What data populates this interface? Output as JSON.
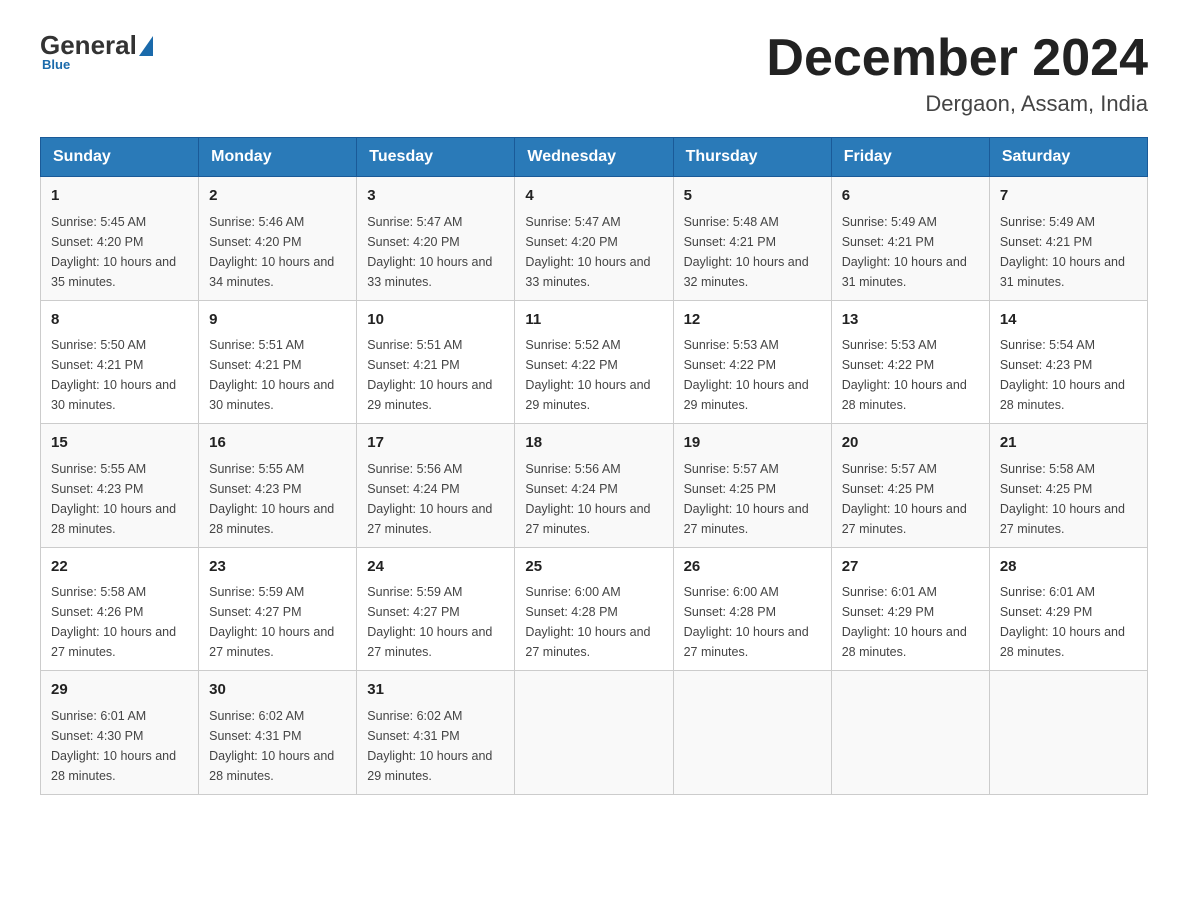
{
  "logo": {
    "general": "General",
    "blue": "Blue",
    "tagline": "Blue"
  },
  "title": {
    "month_year": "December 2024",
    "location": "Dergaon, Assam, India"
  },
  "headers": [
    "Sunday",
    "Monday",
    "Tuesday",
    "Wednesday",
    "Thursday",
    "Friday",
    "Saturday"
  ],
  "weeks": [
    [
      {
        "day": "1",
        "sunrise": "Sunrise: 5:45 AM",
        "sunset": "Sunset: 4:20 PM",
        "daylight": "Daylight: 10 hours and 35 minutes."
      },
      {
        "day": "2",
        "sunrise": "Sunrise: 5:46 AM",
        "sunset": "Sunset: 4:20 PM",
        "daylight": "Daylight: 10 hours and 34 minutes."
      },
      {
        "day": "3",
        "sunrise": "Sunrise: 5:47 AM",
        "sunset": "Sunset: 4:20 PM",
        "daylight": "Daylight: 10 hours and 33 minutes."
      },
      {
        "day": "4",
        "sunrise": "Sunrise: 5:47 AM",
        "sunset": "Sunset: 4:20 PM",
        "daylight": "Daylight: 10 hours and 33 minutes."
      },
      {
        "day": "5",
        "sunrise": "Sunrise: 5:48 AM",
        "sunset": "Sunset: 4:21 PM",
        "daylight": "Daylight: 10 hours and 32 minutes."
      },
      {
        "day": "6",
        "sunrise": "Sunrise: 5:49 AM",
        "sunset": "Sunset: 4:21 PM",
        "daylight": "Daylight: 10 hours and 31 minutes."
      },
      {
        "day": "7",
        "sunrise": "Sunrise: 5:49 AM",
        "sunset": "Sunset: 4:21 PM",
        "daylight": "Daylight: 10 hours and 31 minutes."
      }
    ],
    [
      {
        "day": "8",
        "sunrise": "Sunrise: 5:50 AM",
        "sunset": "Sunset: 4:21 PM",
        "daylight": "Daylight: 10 hours and 30 minutes."
      },
      {
        "day": "9",
        "sunrise": "Sunrise: 5:51 AM",
        "sunset": "Sunset: 4:21 PM",
        "daylight": "Daylight: 10 hours and 30 minutes."
      },
      {
        "day": "10",
        "sunrise": "Sunrise: 5:51 AM",
        "sunset": "Sunset: 4:21 PM",
        "daylight": "Daylight: 10 hours and 29 minutes."
      },
      {
        "day": "11",
        "sunrise": "Sunrise: 5:52 AM",
        "sunset": "Sunset: 4:22 PM",
        "daylight": "Daylight: 10 hours and 29 minutes."
      },
      {
        "day": "12",
        "sunrise": "Sunrise: 5:53 AM",
        "sunset": "Sunset: 4:22 PM",
        "daylight": "Daylight: 10 hours and 29 minutes."
      },
      {
        "day": "13",
        "sunrise": "Sunrise: 5:53 AM",
        "sunset": "Sunset: 4:22 PM",
        "daylight": "Daylight: 10 hours and 28 minutes."
      },
      {
        "day": "14",
        "sunrise": "Sunrise: 5:54 AM",
        "sunset": "Sunset: 4:23 PM",
        "daylight": "Daylight: 10 hours and 28 minutes."
      }
    ],
    [
      {
        "day": "15",
        "sunrise": "Sunrise: 5:55 AM",
        "sunset": "Sunset: 4:23 PM",
        "daylight": "Daylight: 10 hours and 28 minutes."
      },
      {
        "day": "16",
        "sunrise": "Sunrise: 5:55 AM",
        "sunset": "Sunset: 4:23 PM",
        "daylight": "Daylight: 10 hours and 28 minutes."
      },
      {
        "day": "17",
        "sunrise": "Sunrise: 5:56 AM",
        "sunset": "Sunset: 4:24 PM",
        "daylight": "Daylight: 10 hours and 27 minutes."
      },
      {
        "day": "18",
        "sunrise": "Sunrise: 5:56 AM",
        "sunset": "Sunset: 4:24 PM",
        "daylight": "Daylight: 10 hours and 27 minutes."
      },
      {
        "day": "19",
        "sunrise": "Sunrise: 5:57 AM",
        "sunset": "Sunset: 4:25 PM",
        "daylight": "Daylight: 10 hours and 27 minutes."
      },
      {
        "day": "20",
        "sunrise": "Sunrise: 5:57 AM",
        "sunset": "Sunset: 4:25 PM",
        "daylight": "Daylight: 10 hours and 27 minutes."
      },
      {
        "day": "21",
        "sunrise": "Sunrise: 5:58 AM",
        "sunset": "Sunset: 4:25 PM",
        "daylight": "Daylight: 10 hours and 27 minutes."
      }
    ],
    [
      {
        "day": "22",
        "sunrise": "Sunrise: 5:58 AM",
        "sunset": "Sunset: 4:26 PM",
        "daylight": "Daylight: 10 hours and 27 minutes."
      },
      {
        "day": "23",
        "sunrise": "Sunrise: 5:59 AM",
        "sunset": "Sunset: 4:27 PM",
        "daylight": "Daylight: 10 hours and 27 minutes."
      },
      {
        "day": "24",
        "sunrise": "Sunrise: 5:59 AM",
        "sunset": "Sunset: 4:27 PM",
        "daylight": "Daylight: 10 hours and 27 minutes."
      },
      {
        "day": "25",
        "sunrise": "Sunrise: 6:00 AM",
        "sunset": "Sunset: 4:28 PM",
        "daylight": "Daylight: 10 hours and 27 minutes."
      },
      {
        "day": "26",
        "sunrise": "Sunrise: 6:00 AM",
        "sunset": "Sunset: 4:28 PM",
        "daylight": "Daylight: 10 hours and 27 minutes."
      },
      {
        "day": "27",
        "sunrise": "Sunrise: 6:01 AM",
        "sunset": "Sunset: 4:29 PM",
        "daylight": "Daylight: 10 hours and 28 minutes."
      },
      {
        "day": "28",
        "sunrise": "Sunrise: 6:01 AM",
        "sunset": "Sunset: 4:29 PM",
        "daylight": "Daylight: 10 hours and 28 minutes."
      }
    ],
    [
      {
        "day": "29",
        "sunrise": "Sunrise: 6:01 AM",
        "sunset": "Sunset: 4:30 PM",
        "daylight": "Daylight: 10 hours and 28 minutes."
      },
      {
        "day": "30",
        "sunrise": "Sunrise: 6:02 AM",
        "sunset": "Sunset: 4:31 PM",
        "daylight": "Daylight: 10 hours and 28 minutes."
      },
      {
        "day": "31",
        "sunrise": "Sunrise: 6:02 AM",
        "sunset": "Sunset: 4:31 PM",
        "daylight": "Daylight: 10 hours and 29 minutes."
      },
      null,
      null,
      null,
      null
    ]
  ]
}
